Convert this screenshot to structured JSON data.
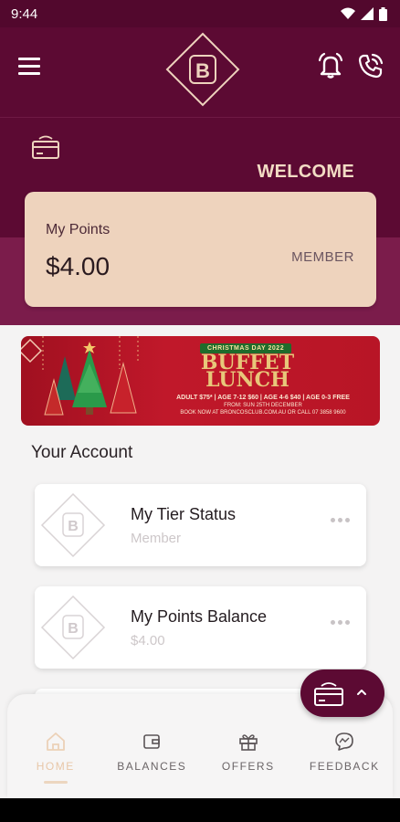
{
  "status_bar": {
    "time": "9:44"
  },
  "header": {
    "logo_letter": "B"
  },
  "welcome": {
    "text": "WELCOME"
  },
  "points_card": {
    "label": "My Points",
    "value": "$4.00",
    "tier": "MEMBER"
  },
  "banner": {
    "badge": "CHRISTMAS DAY 2022",
    "title_line1": "BUFFET",
    "title_line2": "LUNCH",
    "prices": "ADULT $75* | AGE 7-12 $60 | AGE 4-6 $40 | AGE 0-3 FREE",
    "booking_line1": "FROM: SUN 25TH DECEMBER",
    "booking_line2": "BOOK NOW AT BRONCOSCLUB.COM.AU OR CALL 07 3858 9600"
  },
  "account": {
    "title": "Your Account",
    "items": [
      {
        "title": "My Tier Status",
        "subtitle": "Member"
      },
      {
        "title": "My Points Balance",
        "subtitle": "$4.00"
      }
    ]
  },
  "nav": {
    "items": [
      {
        "label": "HOME",
        "icon": "home-icon"
      },
      {
        "label": "BALANCES",
        "icon": "wallet-icon"
      },
      {
        "label": "OFFERS",
        "icon": "gift-icon"
      },
      {
        "label": "FEEDBACK",
        "icon": "chat-icon"
      }
    ]
  },
  "colors": {
    "brand_maroon": "#5c0a33",
    "accent_cream": "#eed3bd",
    "welcome_text": "#f2dcc4"
  }
}
